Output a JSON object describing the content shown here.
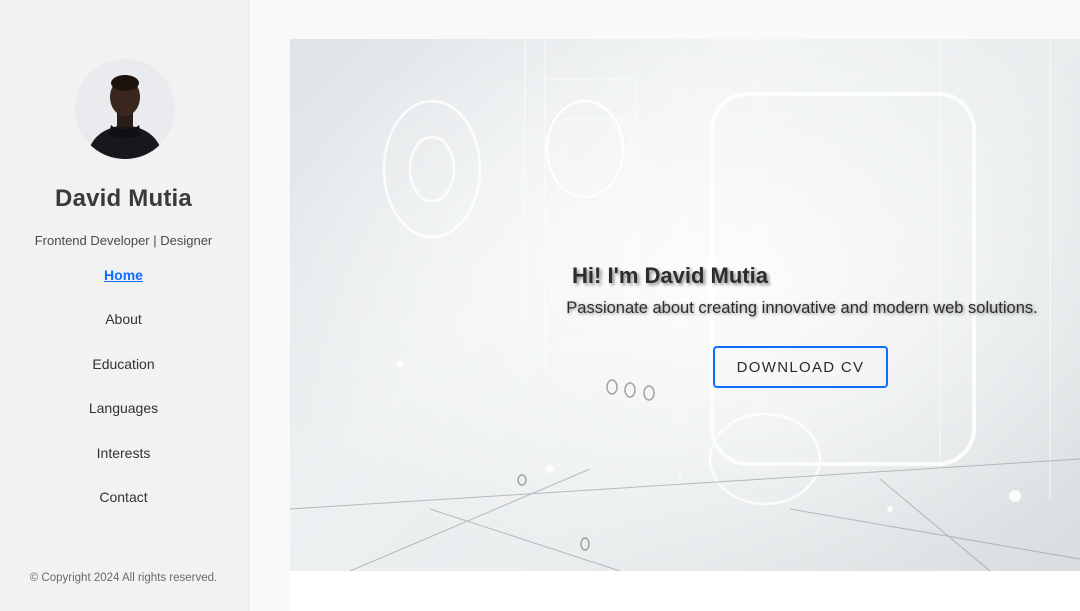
{
  "sidebar": {
    "profile": {
      "name": "David Mutia",
      "tagline": "Frontend Developer | Designer"
    },
    "nav": [
      {
        "label": "Home",
        "active": true
      },
      {
        "label": "About",
        "active": false
      },
      {
        "label": "Education",
        "active": false
      },
      {
        "label": "Languages",
        "active": false
      },
      {
        "label": "Interests",
        "active": false
      },
      {
        "label": "Contact",
        "active": false
      }
    ],
    "copyright": "© Copyright 2024 All rights reserved."
  },
  "hero": {
    "title": "Hi! I'm David Mutia",
    "subtitle": "Passionate about creating innovative and modern web solutions.",
    "cta_label": "DOWNLOAD CV"
  },
  "colors": {
    "accent": "#0d6efd",
    "sidebar_bg": "#f2f2f2",
    "page_bg": "#f8f9fa"
  },
  "icons": {
    "avatar": "person-photo"
  }
}
